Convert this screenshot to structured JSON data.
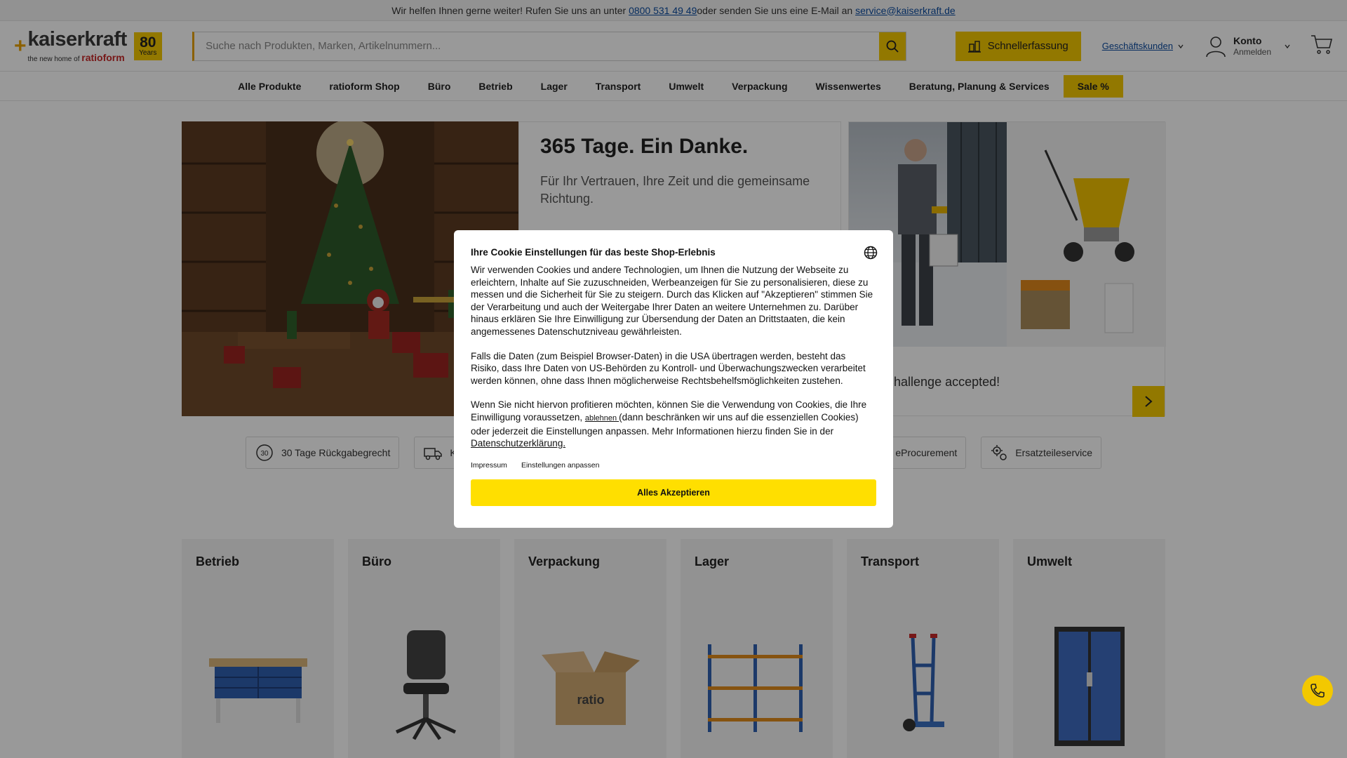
{
  "infobar": {
    "text1": "Wir helfen Ihnen gerne weiter! Rufen Sie uns an unter ",
    "phone": "0800 531 49 49",
    "text2": " oder senden Sie uns eine E-Mail an ",
    "email": "service@kaiserkraft.de"
  },
  "header": {
    "logo_name": "kaiserkraft",
    "logo_sub": "the new home of ",
    "logo_brand": "ratioform",
    "badge_number": "80",
    "badge_label": "Years",
    "search_placeholder": "Suche nach Produkten, Marken, Artikelnummern...",
    "quick_order": "Schnellerfassung",
    "business": "Geschäftskunden",
    "account_title": "Konto",
    "account_sub": "Anmelden"
  },
  "nav": {
    "items": [
      "Alle Produkte",
      "ratioform Shop",
      "Büro",
      "Betrieb",
      "Lager",
      "Transport",
      "Umwelt",
      "Verpackung",
      "Wissenwertes",
      "Beratung, Planung & Services"
    ],
    "sale": "Sale %"
  },
  "hero": {
    "title": "365 Tage. Ein Danke.",
    "desc": "Für Ihr Vertrauen, Ihre Zeit und die gemeinsame Richtung.",
    "second_caption": "er? Challenge accepted!"
  },
  "features": [
    "30 Tage Rückgabegrecht",
    "Kost",
    "eProcurement",
    "Ersatzteileservice"
  ],
  "categories": [
    "Betrieb",
    "Büro",
    "Verpackung",
    "Lager",
    "Transport",
    "Umwelt"
  ],
  "cookie": {
    "title": "Ihre Cookie Einstellungen für das beste Shop-Erlebnis",
    "p1": "Wir verwenden Cookies und andere Technologien, um Ihnen die Nutzung der Webseite zu erleichtern, Inhalte auf Sie zuzuschneiden, Werbeanzeigen für Sie zu personalisieren, diese zu messen und die Sicherheit für Sie zu steigern. Durch das Klicken auf \"Akzeptieren\" stimmen Sie der Verarbeitung und auch der Weitergabe Ihrer Daten an weitere Unternehmen zu. Darüber hinaus erklären Sie Ihre Einwilligung zur Übersendung der Daten an Drittstaaten, die kein angemessenes Datenschutzniveau gewährleisten.",
    "p2": "Falls die Daten (zum Beispiel Browser-Daten) in die USA übertragen werden, besteht das Risiko, dass Ihre Daten von US-Behörden zu Kontroll- und Überwachungszwecken verarbeitet werden können, ohne dass Ihnen möglicherweise Rechtsbehelfsmöglichkeiten zustehen.",
    "p3_a": "Wenn Sie nicht hiervon profitieren möchten, können Sie die Verwendung von Cookies, die Ihre Einwilligung voraussetzen, ",
    "p3_link": "ablehnen ",
    "p3_b": "(dann beschränken wir uns auf die essenziellen Cookies) oder jederzeit die Einstellungen anpassen. Mehr Informationen hierzu finden Sie in der ",
    "p3_link2": "Datenschutzerklärung.",
    "link_impressum": "Impressum",
    "link_settings": "Einstellungen anpassen",
    "accept": "Alles Akzeptieren"
  },
  "colors": {
    "accent": "#f3c800",
    "link": "#0a4a9e",
    "accept": "#ffdf00"
  }
}
